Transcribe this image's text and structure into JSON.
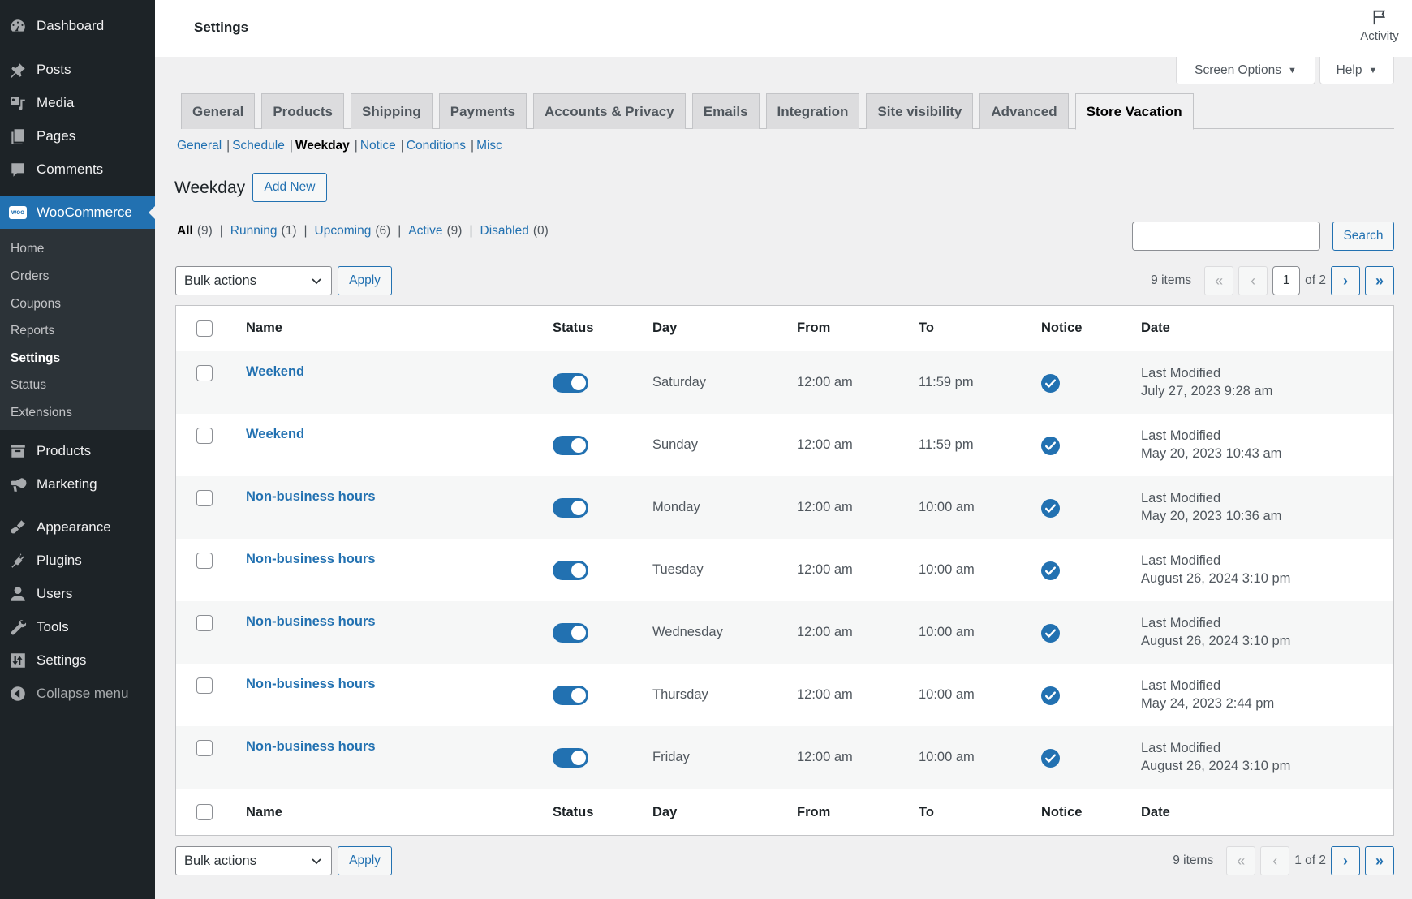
{
  "sidebar": {
    "items": [
      {
        "label": "Dashboard",
        "icon": "dashboard-icon"
      },
      {
        "label": "Posts",
        "icon": "pin-icon"
      },
      {
        "label": "Media",
        "icon": "media-icon"
      },
      {
        "label": "Pages",
        "icon": "pages-icon"
      },
      {
        "label": "Comments",
        "icon": "comment-icon"
      },
      {
        "label": "WooCommerce",
        "icon": "woo-icon"
      },
      {
        "label": "Products",
        "icon": "archive-icon"
      },
      {
        "label": "Marketing",
        "icon": "megaphone-icon"
      },
      {
        "label": "Appearance",
        "icon": "brush-icon"
      },
      {
        "label": "Plugins",
        "icon": "plug-icon"
      },
      {
        "label": "Users",
        "icon": "user-icon"
      },
      {
        "label": "Tools",
        "icon": "wrench-icon"
      },
      {
        "label": "Settings",
        "icon": "settings-sliders-icon"
      },
      {
        "label": "Collapse menu",
        "icon": "collapse-arrow-icon"
      }
    ],
    "woo_badge": "woo",
    "submenu": [
      "Home",
      "Orders",
      "Coupons",
      "Reports",
      "Settings",
      "Status",
      "Extensions"
    ],
    "submenu_current": "Settings"
  },
  "header": {
    "title": "Settings",
    "activity_label": "Activity",
    "screen_options_label": "Screen Options",
    "help_label": "Help",
    "dropdown_arrow": "▼"
  },
  "tabs": [
    "General",
    "Products",
    "Shipping",
    "Payments",
    "Accounts & Privacy",
    "Emails",
    "Integration",
    "Site visibility",
    "Advanced",
    "Store Vacation"
  ],
  "active_tab": "Store Vacation",
  "subnav": [
    "General",
    "Schedule",
    "Weekday",
    "Notice",
    "Conditions",
    "Misc"
  ],
  "subnav_current": "Weekday",
  "subnav_separator": "|",
  "page": {
    "heading": "Weekday",
    "add_new_label": "Add New"
  },
  "filters": [
    {
      "label": "All",
      "count": "(9)"
    },
    {
      "label": "Running",
      "count": "(1)"
    },
    {
      "label": "Upcoming",
      "count": "(6)"
    },
    {
      "label": "Active",
      "count": "(9)"
    },
    {
      "label": "Disabled",
      "count": "(0)"
    }
  ],
  "filter_separator": "|",
  "search": {
    "value": "",
    "placeholder": "",
    "button_label": "Search"
  },
  "bulk": {
    "selected": "Bulk actions",
    "apply_label": "Apply"
  },
  "pagination": {
    "items_label": "9 items",
    "current_page": "1",
    "of_label": "of 2",
    "bottom_label": "1 of 2",
    "first": "«",
    "prev": "‹",
    "next": "›",
    "last": "»"
  },
  "table": {
    "columns": [
      "Name",
      "Status",
      "Day",
      "From",
      "To",
      "Notice",
      "Date"
    ],
    "rows": [
      {
        "name": "Weekend",
        "status": "on",
        "day": "Saturday",
        "from": "12:00 am",
        "to": "11:59 pm",
        "notice": true,
        "date_label": "Last Modified",
        "date": "July 27, 2023 9:28 am"
      },
      {
        "name": "Weekend",
        "status": "on",
        "day": "Sunday",
        "from": "12:00 am",
        "to": "11:59 pm",
        "notice": true,
        "date_label": "Last Modified",
        "date": "May 20, 2023 10:43 am"
      },
      {
        "name": "Non-business hours",
        "status": "on",
        "day": "Monday",
        "from": "12:00 am",
        "to": "10:00 am",
        "notice": true,
        "date_label": "Last Modified",
        "date": "May 20, 2023 10:36 am"
      },
      {
        "name": "Non-business hours",
        "status": "on",
        "day": "Tuesday",
        "from": "12:00 am",
        "to": "10:00 am",
        "notice": true,
        "date_label": "Last Modified",
        "date": "August 26, 2024 3:10 pm"
      },
      {
        "name": "Non-business hours",
        "status": "on",
        "day": "Wednesday",
        "from": "12:00 am",
        "to": "10:00 am",
        "notice": true,
        "date_label": "Last Modified",
        "date": "August 26, 2024 3:10 pm"
      },
      {
        "name": "Non-business hours",
        "status": "on",
        "day": "Thursday",
        "from": "12:00 am",
        "to": "10:00 am",
        "notice": true,
        "date_label": "Last Modified",
        "date": "May 24, 2023 2:44 pm"
      },
      {
        "name": "Non-business hours",
        "status": "on",
        "day": "Friday",
        "from": "12:00 am",
        "to": "10:00 am",
        "notice": true,
        "date_label": "Last Modified",
        "date": "August 26, 2024 3:10 pm"
      }
    ]
  },
  "colors": {
    "accent": "#2271b1",
    "sidebar_bg": "#1d2327",
    "submenu_bg": "#2c3338",
    "page_bg": "#f0f0f1",
    "row_alt": "#f6f7f7"
  }
}
